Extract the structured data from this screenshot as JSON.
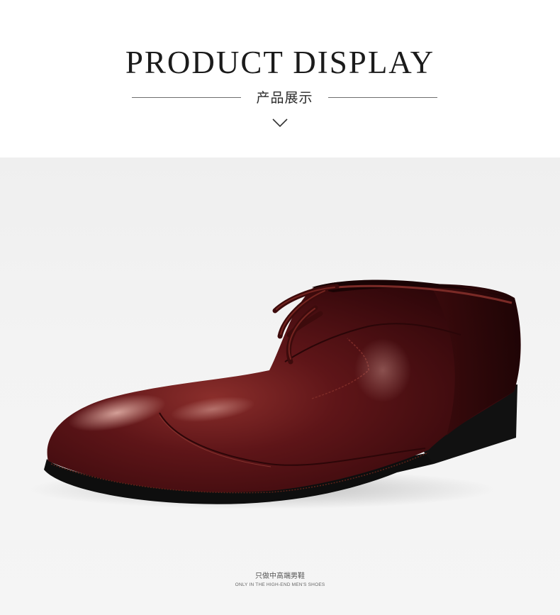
{
  "header": {
    "title": "PRODUCT DISPLAY",
    "subtitle": "产品展示",
    "indicator_icon": "chevron-down-icon"
  },
  "photo": {
    "colors": {
      "leather": "#4a0f10",
      "sole": "#0e0e0e",
      "background": "#f1f1f1"
    }
  },
  "footer": {
    "tagline_cn": "只做中高端男鞋",
    "tagline_en": "ONLY IN THE HIGH-END MEN'S SHOES"
  }
}
